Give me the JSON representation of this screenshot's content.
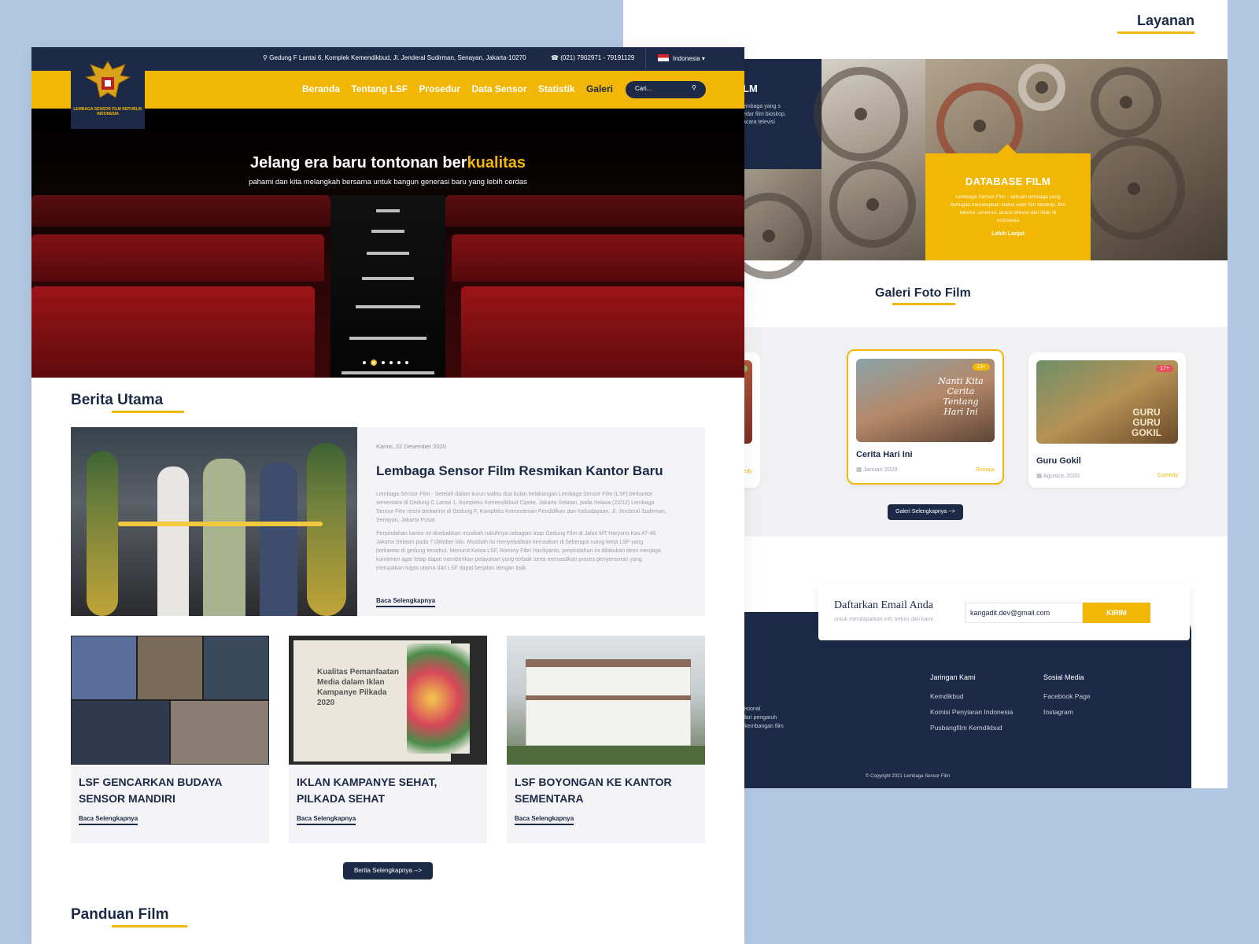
{
  "back": {
    "section_title": "Layanan",
    "service_left_title": "LM",
    "service_left_desc": "embaga yang s edar film bioskop, acara televisi",
    "service_card": {
      "title": "DATABASE FILM",
      "desc": "Lembaga Sensor Film - sebuah lembaga yang bertugas menetapkan status edar film bioskop, film televisi, sinetron, acara televisi dan iklan di Indonesia",
      "link": "Lebih Lanjut"
    },
    "gallery_title": "Galeri Foto Film",
    "films": [
      {
        "name": "",
        "date": "",
        "genre": "Comedy",
        "badge": "SU",
        "badge_color": "#7cc063"
      },
      {
        "name": "Cerita Hari Ini",
        "date": "Januari 2020",
        "genre": "Remaja",
        "badge": "13+",
        "badge_color": "#f2b705",
        "poster_text": "Nanti Kita Cerita Tentang Hari Ini"
      },
      {
        "name": "Guru Gokil",
        "date": "Agustus 2020",
        "genre": "Comedy",
        "badge": "17+",
        "badge_color": "#e84d5b",
        "poster_text": "GURU GURU GOKIL"
      }
    ],
    "gallery_button": "Galeri Selengkapnya -->",
    "subscribe": {
      "title": "Daftarkan Email Anda",
      "desc": "untuk mendapatkan info terkini dari kami.",
      "email": "kangadit.dev@gmail.com",
      "button": "KIRIM"
    },
    "footer_text": [
      "esional",
      "dari pengaruh",
      "rkembangan film"
    ],
    "footer_network": {
      "heading": "Jaringan Kami",
      "items": [
        "Kemdikbud",
        "Komisi Penyiaran Indonesia",
        "Pusbangfilm Kemdikbud"
      ]
    },
    "footer_social": {
      "heading": "Sosial Media",
      "items": [
        "Facebook Page",
        "Instagram"
      ]
    },
    "copyright": "© Copyright 2021 Lembaga Sensor Film"
  },
  "front": {
    "topbar": {
      "address": "Gedung F Lantai 6, Komplek Kemendikbud, Jl. Jenderal Sudirman, Senayan, Jakarta-10270",
      "phone": "(021) 7902971 - 79191129",
      "language": "Indonesia ▾"
    },
    "logo_text": "LEMBAGA SENSOR FILM REPUBLIK INDONESIA",
    "nav": [
      "Beranda",
      "Tentang LSF",
      "Prosedur",
      "Data Sensor",
      "Statistik",
      "Galeri"
    ],
    "nav_active": "Galeri",
    "search_placeholder": "Cari...",
    "hero": {
      "title_main": "Jelang era baru tontonan ber",
      "title_accent": "kualitas",
      "subtitle": "pahami dan kita melangkah bersama untuk bangun generasi baru yang lebih cerdas"
    },
    "news_title": "Berita Utama",
    "featured": {
      "date": "Kamis, 22 Desember 2020",
      "title": "Lembaga Sensor Film Resmikan Kantor Baru",
      "p1": "Lembaga Sensor Film - Setelah dalam kurun waktu dua bulan belakangan Lembaga Sensor Film (LSF) berkantor sementara di Gedung C Lantai 1, Kompleks Kemendikbud Cipete, Jakarta Selatan, pada Selasa (22/12) Lembaga Sensor Film resmi berkantor di Gedung F, Kompleks Kementerian Pendidikan dan Kebudayaan, Jl. Jenderal Sudirman, Senayan, Jakarta Pusat.",
      "p2": "Perpindahan kantor ini disebabkan musibah rubuhnya sebagian atap Gedung Film di Jalan MT Haryono Kav.47-48, Jakarta Selatan pada 7 Oktober lalu. Musibah itu menyebabkan kerusakan di beberapa ruang kerja LSF yang berkantor di gedung tersebut. Menurut Ketua LSF, Rommy Fibri Hardiyanto, perpindahan ini dilakukan demi menjaga komitmen agar tetap dapat memberikan pelayanan yang terbaik serta memastikan proses penyensoran yang merupakan tugas utama dari LSF dapat berjalan dengan baik.",
      "more": "Baca Selengkapnya"
    },
    "news": [
      {
        "title": "LSF GENCARKAN BUDAYA SENSOR MANDIRI",
        "more": "Baca Selengkapnya"
      },
      {
        "title": "IKLAN KAMPANYE SEHAT, PILKADA SEHAT",
        "more": "Baca Selengkapnya",
        "slide_text": "Kualitas Pemanfaatan Media dalam Iklan Kampanye Pilkada 2020"
      },
      {
        "title": "LSF BOYONGAN KE KANTOR SEMENTARA",
        "more": "Baca Selengkapnya"
      }
    ],
    "news_button": "Berita Selengkapnya -->",
    "guide_title": "Panduan Film"
  }
}
